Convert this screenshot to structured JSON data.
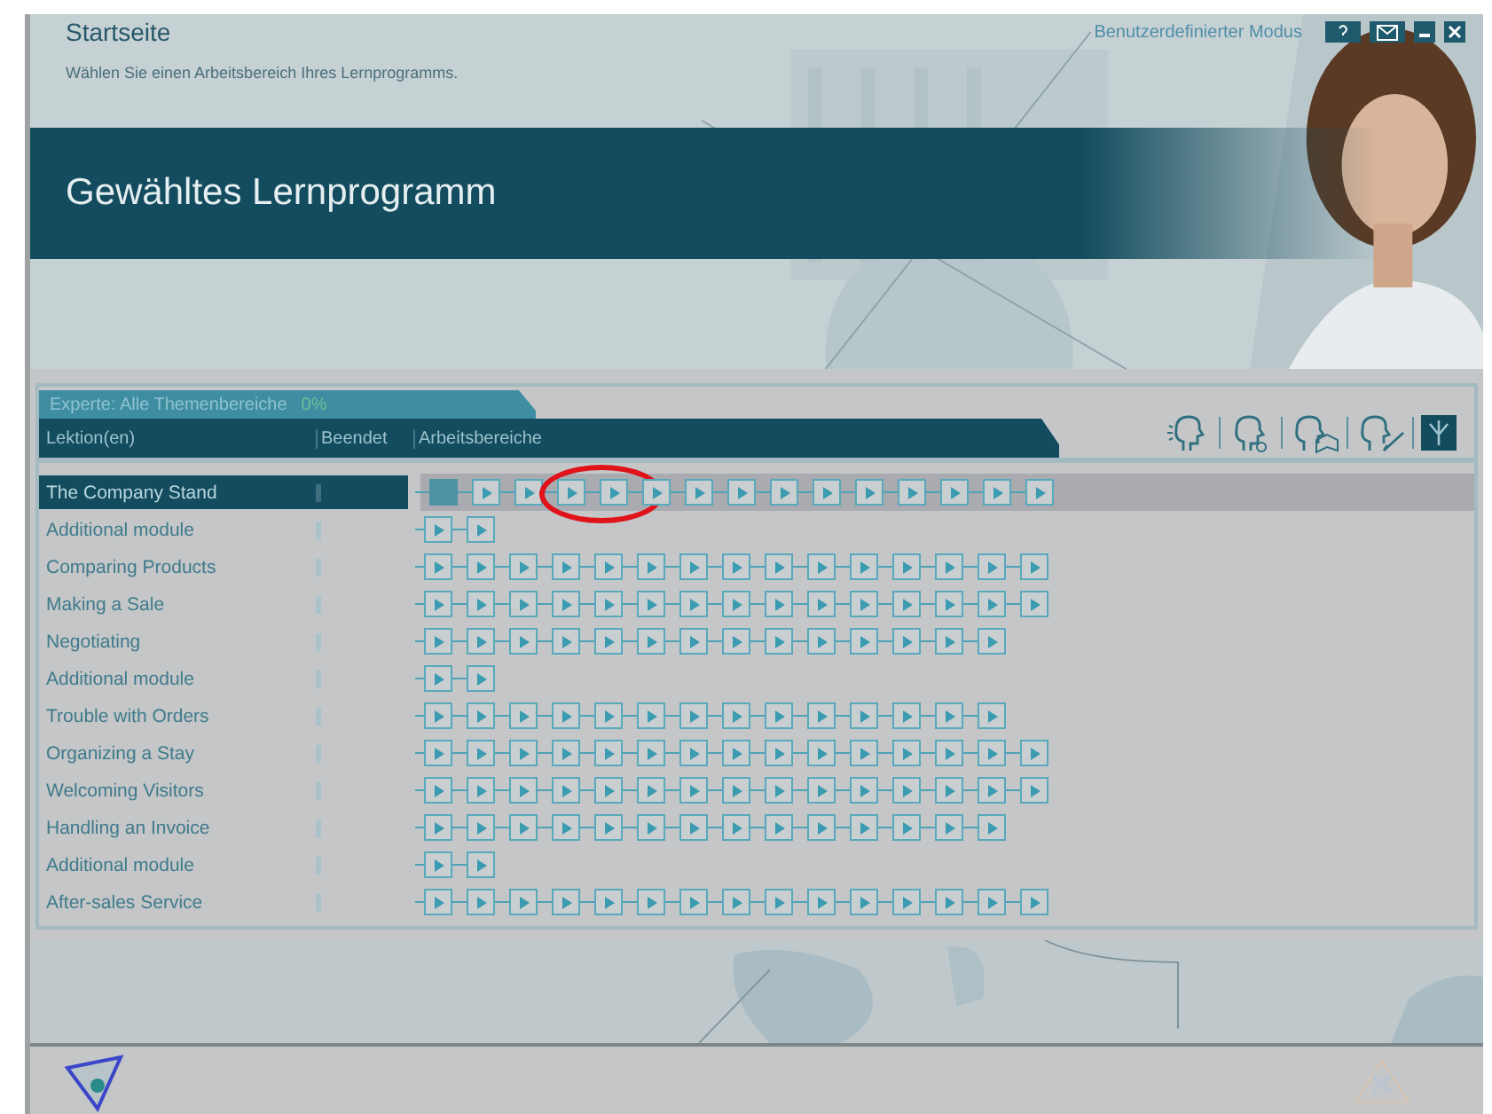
{
  "header": {
    "title": "Startseite",
    "subtitle": "Wählen Sie einen Arbeitsbereich Ihres Lernprogramms.",
    "mode_link": "Benutzerdefinierter Modus"
  },
  "banner": {
    "title": "Gewähltes Lernprogramm"
  },
  "panel": {
    "tab": {
      "label": "Experte: Alle Themenbereiche",
      "progress": "0%"
    },
    "columns": [
      "Lektion(en)",
      "Beendet",
      "Arbeitsbereiche"
    ],
    "rows": [
      {
        "name": "The Company Stand",
        "selected": true,
        "steps": [
          {
            "current": true
          },
          {
            "current": false
          },
          {
            "current": false
          },
          {
            "current": false,
            "circled": true
          },
          {
            "current": false
          },
          {
            "current": false
          },
          {
            "current": false
          },
          {
            "current": false
          },
          {
            "current": false
          },
          {
            "current": false
          },
          {
            "current": false
          },
          {
            "current": false
          },
          {
            "current": false
          },
          {
            "current": false
          },
          {
            "current": false
          }
        ]
      },
      {
        "name": "Additional module",
        "selected": false,
        "steps": [
          {
            "current": false
          },
          {
            "current": false
          }
        ]
      },
      {
        "name": "Comparing Products",
        "selected": false,
        "steps": [
          {
            "current": false
          },
          {
            "current": false
          },
          {
            "current": false
          },
          {
            "current": false
          },
          {
            "current": false
          },
          {
            "current": false
          },
          {
            "current": false
          },
          {
            "current": false
          },
          {
            "current": false
          },
          {
            "current": false
          },
          {
            "current": false
          },
          {
            "current": false
          },
          {
            "current": false
          },
          {
            "current": false
          },
          {
            "current": false
          }
        ]
      },
      {
        "name": "Making a Sale",
        "selected": false,
        "steps": [
          {
            "current": false
          },
          {
            "current": false
          },
          {
            "current": false
          },
          {
            "current": false
          },
          {
            "current": false
          },
          {
            "current": false
          },
          {
            "current": false
          },
          {
            "current": false
          },
          {
            "current": false
          },
          {
            "current": false
          },
          {
            "current": false
          },
          {
            "current": false
          },
          {
            "current": false
          },
          {
            "current": false
          },
          {
            "current": false
          }
        ]
      },
      {
        "name": "Negotiating",
        "selected": false,
        "steps": [
          {
            "current": false
          },
          {
            "current": false
          },
          {
            "current": false
          },
          {
            "current": false
          },
          {
            "current": false
          },
          {
            "current": false
          },
          {
            "current": false
          },
          {
            "current": false
          },
          {
            "current": false
          },
          {
            "current": false
          },
          {
            "current": false
          },
          {
            "current": false
          },
          {
            "current": false
          },
          {
            "current": false
          }
        ]
      },
      {
        "name": "Additional module",
        "selected": false,
        "steps": [
          {
            "current": false
          },
          {
            "current": false
          }
        ]
      },
      {
        "name": "Trouble with Orders",
        "selected": false,
        "steps": [
          {
            "current": false
          },
          {
            "current": false
          },
          {
            "current": false
          },
          {
            "current": false
          },
          {
            "current": false
          },
          {
            "current": false
          },
          {
            "current": false
          },
          {
            "current": false
          },
          {
            "current": false
          },
          {
            "current": false
          },
          {
            "current": false
          },
          {
            "current": false
          },
          {
            "current": false
          },
          {
            "current": false
          }
        ]
      },
      {
        "name": "Organizing a Stay",
        "selected": false,
        "steps": [
          {
            "current": false
          },
          {
            "current": false
          },
          {
            "current": false
          },
          {
            "current": false
          },
          {
            "current": false
          },
          {
            "current": false
          },
          {
            "current": false
          },
          {
            "current": false
          },
          {
            "current": false
          },
          {
            "current": false
          },
          {
            "current": false
          },
          {
            "current": false
          },
          {
            "current": false
          },
          {
            "current": false
          },
          {
            "current": false
          }
        ]
      },
      {
        "name": "Welcoming Visitors",
        "selected": false,
        "steps": [
          {
            "current": false
          },
          {
            "current": false
          },
          {
            "current": false
          },
          {
            "current": false
          },
          {
            "current": false
          },
          {
            "current": false
          },
          {
            "current": false
          },
          {
            "current": false
          },
          {
            "current": false
          },
          {
            "current": false
          },
          {
            "current": false
          },
          {
            "current": false
          },
          {
            "current": false
          },
          {
            "current": false
          },
          {
            "current": false
          }
        ]
      },
      {
        "name": "Handling an Invoice",
        "selected": false,
        "steps": [
          {
            "current": false
          },
          {
            "current": false
          },
          {
            "current": false
          },
          {
            "current": false
          },
          {
            "current": false
          },
          {
            "current": false
          },
          {
            "current": false
          },
          {
            "current": false
          },
          {
            "current": false
          },
          {
            "current": false
          },
          {
            "current": false
          },
          {
            "current": false
          },
          {
            "current": false
          },
          {
            "current": false
          }
        ]
      },
      {
        "name": "Additional module",
        "selected": false,
        "steps": [
          {
            "current": false
          },
          {
            "current": false
          }
        ]
      },
      {
        "name": "After-sales Service",
        "selected": false,
        "steps": [
          {
            "current": false
          },
          {
            "current": false
          },
          {
            "current": false
          },
          {
            "current": false
          },
          {
            "current": false
          },
          {
            "current": false
          },
          {
            "current": false
          },
          {
            "current": false
          },
          {
            "current": false
          },
          {
            "current": false
          },
          {
            "current": false
          },
          {
            "current": false
          },
          {
            "current": false
          },
          {
            "current": false
          },
          {
            "current": false
          }
        ]
      }
    ]
  }
}
